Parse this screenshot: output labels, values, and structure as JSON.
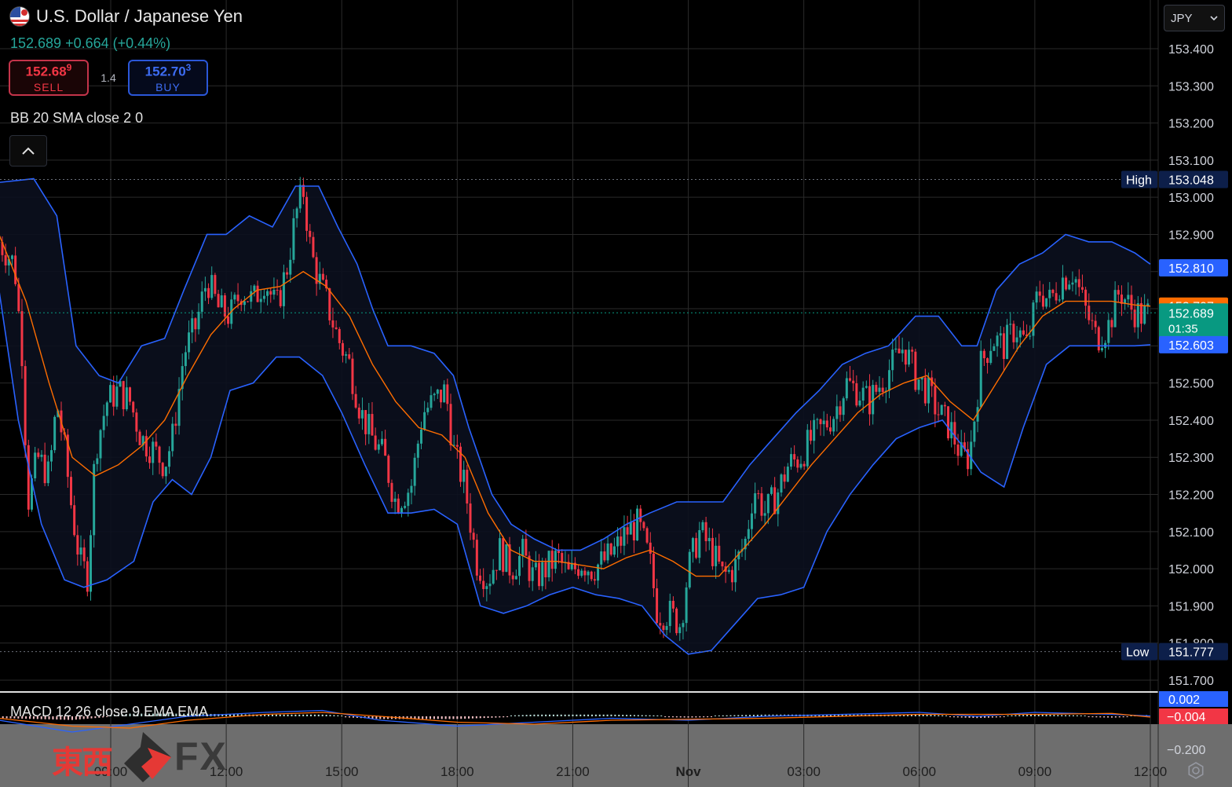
{
  "header": {
    "title": "U.S. Dollar / Japanese Yen",
    "quote": "152.689 +0.664 (+0.44%)",
    "sell": {
      "price_main": "152.68",
      "price_pip": "9",
      "label": "SELL"
    },
    "buy": {
      "price_main": "152.70",
      "price_pip": "3",
      "label": "BUY"
    },
    "spread": "1.4",
    "indicator": "BB 20 SMA close 2 0",
    "currency": "JPY"
  },
  "macd": {
    "label": "MACD 12 26 close 9 EMA EMA"
  },
  "brand": {
    "kanji": "東西",
    "fx": "FX"
  },
  "colors": {
    "up": "#26a69a",
    "down": "#f23645",
    "bb_band": "#2962ff",
    "bb_basis": "#ff6d00",
    "last_price": "#089981",
    "high_low_tag": "#0d1f4a"
  },
  "chart_data": {
    "type": "candlestick",
    "title": "U.S. Dollar / Japanese Yen",
    "ylim": [
      151.7,
      153.45
    ],
    "y_ticks": [
      "153.400",
      "153.300",
      "153.200",
      "153.100",
      "153.000",
      "152.900",
      "152.800",
      "152.700",
      "152.600",
      "152.500",
      "152.400",
      "152.300",
      "152.200",
      "152.100",
      "152.000",
      "151.900",
      "151.800",
      "151.700"
    ],
    "x_ticks": [
      "09:00",
      "12:00",
      "15:00",
      "18:00",
      "21:00",
      "Nov",
      "03:00",
      "06:00",
      "09:00",
      "12:00"
    ],
    "x_tick_hours": [
      9,
      12,
      15,
      18,
      21,
      24,
      27,
      30,
      33,
      36
    ],
    "xlim_hours": [
      6.1,
      36.25
    ],
    "grid": true,
    "close_path": [
      [
        6.1,
        152.88
      ],
      [
        6.5,
        152.82
      ],
      [
        6.7,
        152.58
      ],
      [
        6.85,
        152.18
      ],
      [
        7.1,
        152.3
      ],
      [
        7.4,
        152.25
      ],
      [
        7.6,
        152.45
      ],
      [
        7.8,
        152.32
      ],
      [
        8.0,
        152.15
      ],
      [
        8.2,
        152.02
      ],
      [
        8.4,
        151.98
      ],
      [
        8.6,
        152.32
      ],
      [
        8.9,
        152.45
      ],
      [
        9.2,
        152.48
      ],
      [
        9.5,
        152.45
      ],
      [
        9.8,
        152.35
      ],
      [
        10.1,
        152.32
      ],
      [
        10.4,
        152.28
      ],
      [
        10.6,
        152.35
      ],
      [
        10.9,
        152.58
      ],
      [
        11.2,
        152.65
      ],
      [
        11.5,
        152.78
      ],
      [
        11.8,
        152.7
      ],
      [
        12.1,
        152.68
      ],
      [
        12.4,
        152.75
      ],
      [
        12.7,
        152.72
      ],
      [
        13.0,
        152.78
      ],
      [
        13.3,
        152.7
      ],
      [
        13.6,
        152.82
      ],
      [
        13.8,
        152.95
      ],
      [
        14.0,
        153.02
      ],
      [
        14.2,
        152.85
      ],
      [
        14.4,
        152.78
      ],
      [
        14.6,
        152.72
      ],
      [
        14.9,
        152.62
      ],
      [
        15.2,
        152.55
      ],
      [
        15.5,
        152.42
      ],
      [
        15.8,
        152.35
      ],
      [
        16.1,
        152.3
      ],
      [
        16.4,
        152.18
      ],
      [
        16.8,
        152.22
      ],
      [
        17.1,
        152.42
      ],
      [
        17.4,
        152.45
      ],
      [
        17.7,
        152.48
      ],
      [
        17.9,
        152.32
      ],
      [
        18.2,
        152.22
      ],
      [
        18.5,
        152.02
      ],
      [
        18.8,
        151.97
      ],
      [
        19.1,
        152.05
      ],
      [
        19.4,
        152.0
      ],
      [
        19.7,
        152.04
      ],
      [
        20.0,
        151.97
      ],
      [
        20.3,
        152.0
      ],
      [
        20.6,
        152.03
      ],
      [
        20.9,
        151.98
      ],
      [
        21.2,
        152.02
      ],
      [
        21.5,
        152.0
      ],
      [
        21.8,
        152.02
      ],
      [
        22.1,
        152.05
      ],
      [
        22.4,
        152.1
      ],
      [
        22.7,
        152.12
      ],
      [
        23.0,
        152.02
      ],
      [
        23.2,
        151.88
      ],
      [
        23.5,
        151.88
      ],
      [
        23.8,
        151.85
      ],
      [
        24.0,
        152.0
      ],
      [
        24.3,
        152.1
      ],
      [
        24.6,
        152.05
      ],
      [
        24.9,
        151.98
      ],
      [
        25.2,
        152.0
      ],
      [
        25.5,
        152.08
      ],
      [
        25.7,
        152.22
      ],
      [
        26.0,
        152.15
      ],
      [
        26.3,
        152.2
      ],
      [
        26.6,
        152.28
      ],
      [
        26.9,
        152.3
      ],
      [
        27.2,
        152.35
      ],
      [
        27.5,
        152.38
      ],
      [
        27.8,
        152.42
      ],
      [
        28.1,
        152.5
      ],
      [
        28.4,
        152.48
      ],
      [
        28.7,
        152.45
      ],
      [
        29.0,
        152.5
      ],
      [
        29.3,
        152.55
      ],
      [
        29.6,
        152.6
      ],
      [
        29.9,
        152.52
      ],
      [
        30.2,
        152.48
      ],
      [
        30.5,
        152.42
      ],
      [
        30.8,
        152.38
      ],
      [
        31.1,
        152.3
      ],
      [
        31.3,
        152.3
      ],
      [
        31.6,
        152.55
      ],
      [
        31.9,
        152.62
      ],
      [
        32.2,
        152.6
      ],
      [
        32.5,
        152.65
      ],
      [
        32.8,
        152.6
      ],
      [
        33.1,
        152.75
      ],
      [
        33.4,
        152.72
      ],
      [
        33.7,
        152.78
      ],
      [
        34.0,
        152.8
      ],
      [
        34.3,
        152.7
      ],
      [
        34.6,
        152.62
      ],
      [
        34.9,
        152.65
      ],
      [
        35.2,
        152.75
      ],
      [
        35.5,
        152.7
      ],
      [
        35.8,
        152.68
      ],
      [
        36.0,
        152.69
      ]
    ],
    "bollinger": {
      "upper": [
        [
          6.1,
          153.04
        ],
        [
          7.0,
          153.05
        ],
        [
          7.6,
          152.95
        ],
        [
          8.1,
          152.6
        ],
        [
          8.7,
          152.52
        ],
        [
          9.2,
          152.5
        ],
        [
          9.8,
          152.6
        ],
        [
          10.4,
          152.62
        ],
        [
          10.9,
          152.75
        ],
        [
          11.5,
          152.9
        ],
        [
          12.0,
          152.9
        ],
        [
          12.6,
          152.95
        ],
        [
          13.2,
          152.92
        ],
        [
          13.8,
          153.03
        ],
        [
          14.4,
          153.03
        ],
        [
          14.9,
          152.92
        ],
        [
          15.4,
          152.82
        ],
        [
          15.8,
          152.7
        ],
        [
          16.2,
          152.6
        ],
        [
          16.8,
          152.6
        ],
        [
          17.4,
          152.58
        ],
        [
          17.9,
          152.52
        ],
        [
          18.3,
          152.38
        ],
        [
          18.9,
          152.2
        ],
        [
          19.4,
          152.12
        ],
        [
          20.0,
          152.08
        ],
        [
          20.6,
          152.05
        ],
        [
          21.2,
          152.05
        ],
        [
          21.8,
          152.08
        ],
        [
          22.4,
          152.12
        ],
        [
          23.0,
          152.15
        ],
        [
          23.7,
          152.18
        ],
        [
          24.3,
          152.18
        ],
        [
          24.9,
          152.18
        ],
        [
          25.6,
          152.28
        ],
        [
          26.2,
          152.35
        ],
        [
          26.8,
          152.42
        ],
        [
          27.4,
          152.48
        ],
        [
          28.0,
          152.55
        ],
        [
          28.6,
          152.58
        ],
        [
          29.2,
          152.6
        ],
        [
          29.9,
          152.68
        ],
        [
          30.5,
          152.68
        ],
        [
          31.1,
          152.6
        ],
        [
          31.5,
          152.6
        ],
        [
          32.0,
          152.75
        ],
        [
          32.6,
          152.82
        ],
        [
          33.2,
          152.85
        ],
        [
          33.8,
          152.9
        ],
        [
          34.4,
          152.88
        ],
        [
          35.0,
          152.88
        ],
        [
          35.6,
          152.85
        ],
        [
          36.0,
          152.82
        ]
      ],
      "basis": [
        [
          6.1,
          152.9
        ],
        [
          6.8,
          152.72
        ],
        [
          7.4,
          152.5
        ],
        [
          8.0,
          152.3
        ],
        [
          8.6,
          152.25
        ],
        [
          9.2,
          152.28
        ],
        [
          9.8,
          152.33
        ],
        [
          10.4,
          152.4
        ],
        [
          11.0,
          152.52
        ],
        [
          11.6,
          152.63
        ],
        [
          12.2,
          152.7
        ],
        [
          12.8,
          152.75
        ],
        [
          13.4,
          152.76
        ],
        [
          14.0,
          152.8
        ],
        [
          14.6,
          152.76
        ],
        [
          15.2,
          152.68
        ],
        [
          15.8,
          152.55
        ],
        [
          16.4,
          152.45
        ],
        [
          17.0,
          152.38
        ],
        [
          17.6,
          152.36
        ],
        [
          18.2,
          152.3
        ],
        [
          18.8,
          152.15
        ],
        [
          19.4,
          152.05
        ],
        [
          20.0,
          152.02
        ],
        [
          20.6,
          152.02
        ],
        [
          21.2,
          152.01
        ],
        [
          21.8,
          152.0
        ],
        [
          22.4,
          152.03
        ],
        [
          23.0,
          152.05
        ],
        [
          23.6,
          152.02
        ],
        [
          24.2,
          151.98
        ],
        [
          24.8,
          151.98
        ],
        [
          25.4,
          152.05
        ],
        [
          26.0,
          152.12
        ],
        [
          26.6,
          152.2
        ],
        [
          27.2,
          152.28
        ],
        [
          27.8,
          152.35
        ],
        [
          28.4,
          152.42
        ],
        [
          29.0,
          152.47
        ],
        [
          29.6,
          152.5
        ],
        [
          30.2,
          152.52
        ],
        [
          30.8,
          152.45
        ],
        [
          31.4,
          152.4
        ],
        [
          32.0,
          152.5
        ],
        [
          32.6,
          152.6
        ],
        [
          33.2,
          152.68
        ],
        [
          33.8,
          152.72
        ],
        [
          34.4,
          152.72
        ],
        [
          35.0,
          152.72
        ],
        [
          35.6,
          152.71
        ],
        [
          36.0,
          152.707
        ]
      ],
      "lower": [
        [
          6.1,
          152.75
        ],
        [
          6.6,
          152.4
        ],
        [
          7.2,
          152.12
        ],
        [
          7.8,
          151.97
        ],
        [
          8.3,
          151.95
        ],
        [
          8.9,
          151.97
        ],
        [
          9.6,
          152.02
        ],
        [
          10.1,
          152.18
        ],
        [
          10.6,
          152.24
        ],
        [
          11.1,
          152.2
        ],
        [
          11.6,
          152.3
        ],
        [
          12.1,
          152.48
        ],
        [
          12.7,
          152.5
        ],
        [
          13.3,
          152.57
        ],
        [
          13.9,
          152.57
        ],
        [
          14.5,
          152.52
        ],
        [
          15.0,
          152.42
        ],
        [
          15.6,
          152.28
        ],
        [
          16.2,
          152.15
        ],
        [
          16.8,
          152.15
        ],
        [
          17.4,
          152.16
        ],
        [
          18.0,
          152.12
        ],
        [
          18.6,
          151.9
        ],
        [
          19.2,
          151.88
        ],
        [
          19.8,
          151.9
        ],
        [
          20.4,
          151.93
        ],
        [
          21.0,
          151.95
        ],
        [
          21.6,
          151.93
        ],
        [
          22.2,
          151.92
        ],
        [
          22.8,
          151.9
        ],
        [
          23.4,
          151.82
        ],
        [
          24.0,
          151.77
        ],
        [
          24.6,
          151.78
        ],
        [
          25.2,
          151.85
        ],
        [
          25.8,
          151.92
        ],
        [
          26.4,
          151.93
        ],
        [
          27.0,
          151.95
        ],
        [
          27.6,
          152.1
        ],
        [
          28.2,
          152.2
        ],
        [
          28.8,
          152.28
        ],
        [
          29.4,
          152.35
        ],
        [
          30.0,
          152.38
        ],
        [
          30.6,
          152.4
        ],
        [
          31.2,
          152.32
        ],
        [
          31.6,
          152.26
        ],
        [
          32.2,
          152.22
        ],
        [
          32.7,
          152.38
        ],
        [
          33.3,
          152.55
        ],
        [
          33.9,
          152.6
        ],
        [
          34.5,
          152.6
        ],
        [
          35.1,
          152.6
        ],
        [
          35.6,
          152.6
        ],
        [
          36.0,
          152.603
        ]
      ]
    },
    "price_tags": [
      {
        "label": "High",
        "value": "153.048",
        "kind": "high"
      },
      {
        "label": "",
        "value": "152.810",
        "kind": "bb_upper"
      },
      {
        "label": "",
        "value": "152.707",
        "kind": "bb_basis"
      },
      {
        "label": "01:35",
        "value": "152.689",
        "kind": "last"
      },
      {
        "label": "",
        "value": "152.603",
        "kind": "bb_lower"
      },
      {
        "label": "Low",
        "value": "151.777",
        "kind": "low"
      }
    ],
    "macd": {
      "ylim": [
        -0.25,
        0.05
      ],
      "tags": [
        {
          "value": "0.002",
          "kind": "macd"
        },
        {
          "value": "−0.004",
          "kind": "signal"
        }
      ],
      "y_tick": "−0.200",
      "macd_path": [
        [
          6.1,
          -0.02
        ],
        [
          8.0,
          -0.08
        ],
        [
          9.5,
          -0.04
        ],
        [
          11,
          0.0
        ],
        [
          13,
          0.02
        ],
        [
          14.5,
          0.03
        ],
        [
          16,
          -0.02
        ],
        [
          18,
          -0.05
        ],
        [
          20,
          -0.03
        ],
        [
          22,
          -0.01
        ],
        [
          24,
          -0.02
        ],
        [
          26,
          0.0
        ],
        [
          28,
          0.01
        ],
        [
          30,
          0.02
        ],
        [
          31.5,
          0.0
        ],
        [
          33,
          0.02
        ],
        [
          35,
          0.01
        ],
        [
          36,
          0.002
        ]
      ],
      "signal_path": [
        [
          6.1,
          -0.01
        ],
        [
          8.0,
          -0.05
        ],
        [
          9.5,
          -0.06
        ],
        [
          11,
          -0.02
        ],
        [
          13,
          0.01
        ],
        [
          14.5,
          0.02
        ],
        [
          16,
          0.0
        ],
        [
          18,
          -0.03
        ],
        [
          20,
          -0.04
        ],
        [
          22,
          -0.02
        ],
        [
          24,
          -0.015
        ],
        [
          26,
          -0.01
        ],
        [
          28,
          0.0
        ],
        [
          30,
          0.01
        ],
        [
          31.5,
          0.01
        ],
        [
          33,
          0.01
        ],
        [
          35,
          0.015
        ],
        [
          36,
          -0.004
        ]
      ]
    }
  }
}
